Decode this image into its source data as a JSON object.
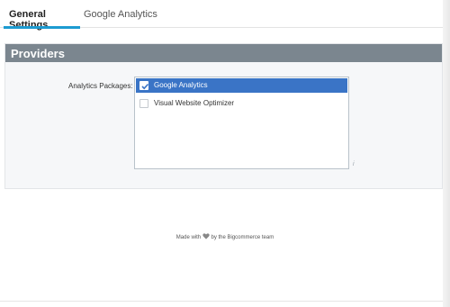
{
  "tabs": [
    {
      "label": "General Settings",
      "active": true
    },
    {
      "label": "Google Analytics",
      "active": false
    }
  ],
  "providers": {
    "title": "Providers",
    "field_label": "Analytics Packages:",
    "options": [
      {
        "label": "Google Analytics",
        "checked": true
      },
      {
        "label": "Visual Website Optimizer",
        "checked": false
      }
    ],
    "info_mark": "i"
  },
  "footer": {
    "before": "Made with",
    "heart_icon": "heart-icon",
    "after": "by the Bigcommerce team"
  },
  "colors": {
    "accent": "#1d9bd1",
    "header_bg": "#7b868f",
    "selected_bg": "#3a74c6",
    "heart": "#888888"
  }
}
